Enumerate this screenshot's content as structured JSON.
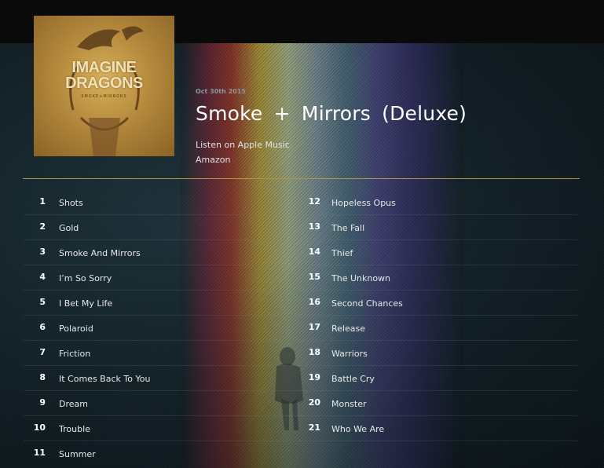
{
  "album": {
    "release_date": "Oct 30th 2015",
    "title": "Smoke + Mirrors (Deluxe)",
    "cover": {
      "band_name": "IMAGINE DRAGONS",
      "subtitle": "SMOKE+MIRRORS"
    }
  },
  "links": {
    "apple_music": "Listen on Apple Music",
    "amazon": "Amazon"
  },
  "tracks_left": [
    {
      "num": "1",
      "name": "Shots"
    },
    {
      "num": "2",
      "name": "Gold"
    },
    {
      "num": "3",
      "name": "Smoke And Mirrors"
    },
    {
      "num": "4",
      "name": "I’m So Sorry"
    },
    {
      "num": "5",
      "name": "I Bet My Life"
    },
    {
      "num": "6",
      "name": "Polaroid"
    },
    {
      "num": "7",
      "name": "Friction"
    },
    {
      "num": "8",
      "name": "It Comes Back To You"
    },
    {
      "num": "9",
      "name": "Dream"
    },
    {
      "num": "10",
      "name": "Trouble"
    },
    {
      "num": "11",
      "name": "Summer"
    }
  ],
  "tracks_right": [
    {
      "num": "12",
      "name": "Hopeless Opus"
    },
    {
      "num": "13",
      "name": "The Fall"
    },
    {
      "num": "14",
      "name": "Thief"
    },
    {
      "num": "15",
      "name": "The Unknown"
    },
    {
      "num": "16",
      "name": "Second Chances"
    },
    {
      "num": "17",
      "name": "Release"
    },
    {
      "num": "18",
      "name": "Warriors"
    },
    {
      "num": "19",
      "name": "Battle Cry"
    },
    {
      "num": "20",
      "name": "Monster"
    },
    {
      "num": "21",
      "name": "Who We Are"
    }
  ],
  "colors": {
    "accent_divider": "#b39549",
    "background": "#0b1418",
    "top_bar": "#0a0a0a"
  }
}
